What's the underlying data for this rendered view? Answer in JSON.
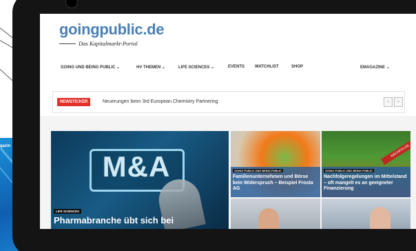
{
  "site": {
    "logo_title": "goingpublic.de",
    "logo_subtitle": "Das Kapitalmarkt-Portal"
  },
  "left_panel": {
    "text": "gazin"
  },
  "nav": {
    "items": [
      {
        "label": "GOING UND BEING PUBLIC ⌄"
      },
      {
        "label": "HV THEMEN ⌄"
      },
      {
        "label": "LIFE SCIENCES ⌄"
      },
      {
        "label": "EVENTS"
      },
      {
        "label": "WATCHLIST"
      },
      {
        "label": "SHOP"
      }
    ],
    "right_item": "EMAGAZINE ⌄"
  },
  "ticker": {
    "badge": "NEWSTICKER",
    "text": "Neuerungen beim 3rd European Chemistry Partnering",
    "prev": "‹",
    "next": "›"
  },
  "hero": {
    "image_text": "M&A",
    "badge": "LIFE SCIENCES",
    "title": "Pharmabranche übt sich bei"
  },
  "tiles": [
    {
      "badge": "GOING PUBLIC UND BEING PUBLIC",
      "title": "Familienunternehmen und Börse kein Widerspruch – Beispiel Frosta AG"
    },
    {
      "badge": "GOING PUBLIC UND BEING PUBLIC",
      "ribbon": "NACHFOLGE",
      "title": "Nachfolgeregelungen im Mittelstand – oft mangelt es an geeigneter Finanzierung"
    }
  ],
  "colors": {
    "brand_blue": "#4a7fb6",
    "ticker_red": "#e4302b",
    "overlay_blue": "#215ca0"
  }
}
